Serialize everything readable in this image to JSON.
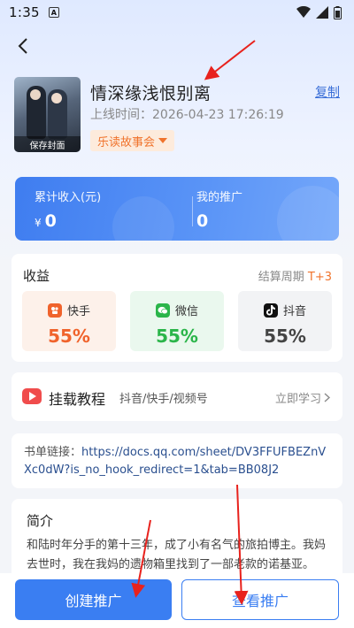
{
  "status_bar": {
    "time": "1:35",
    "notif_glyph": "A"
  },
  "book": {
    "title": "情深缘浅恨别离",
    "copy_label": "复制",
    "online_time": "上线时间：2026-04-23 17:26:19",
    "author_tag": "乐读故事会",
    "save_cover_label": "保存封面"
  },
  "stats": {
    "income_label": "累计收入(元)",
    "income_currency": "¥",
    "income_value": "0",
    "promo_label": "我的推广",
    "promo_value": "0"
  },
  "earnings": {
    "title": "收益",
    "period_label": "结算周期",
    "period_value": "T+3",
    "platforms": [
      {
        "name": "快手",
        "percent": "55%",
        "color": "#f0632c",
        "icon": "kuaishou-icon"
      },
      {
        "name": "微信",
        "percent": "55%",
        "color": "#2bb54a",
        "icon": "wechat-icon"
      },
      {
        "name": "抖音",
        "percent": "55%",
        "color": "#333333",
        "icon": "douyin-icon"
      }
    ]
  },
  "tutorial": {
    "title": "挂载教程",
    "subtitle": "抖音/快手/视频号",
    "learn_label": "立即学习"
  },
  "book_link": {
    "label": "书单链接：",
    "url": "https://docs.qq.com/sheet/DV3FFUFBEZnVXc0dW?is_no_hook_redirect=1&tab=BB08J2"
  },
  "intro": {
    "title": "简介",
    "text": "和陆时年分手的第十三年，成了小有名气的旅拍博主。我妈去世时，我在我妈的遗物箱里找到了一部老款的诺基亚。"
  },
  "actions": {
    "create_label": "创建推广",
    "view_label": "查看推广"
  },
  "colors": {
    "accent": "#3a7ef2",
    "orange": "#f0732c",
    "annotation": "#e8221d"
  }
}
